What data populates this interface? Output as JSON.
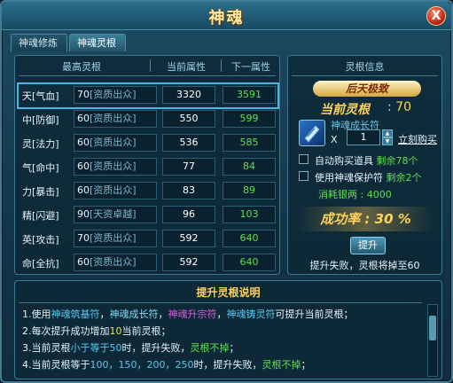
{
  "window": {
    "title": "神魂",
    "close_label": "X"
  },
  "tabs": [
    {
      "label": "神魂修炼"
    },
    {
      "label": "神魂灵根"
    }
  ],
  "table": {
    "headers": [
      "最高灵根",
      "当前属性",
      "下一属性"
    ],
    "rows": [
      {
        "name": "天[气血]",
        "level": "70",
        "quality": "[资质出众]",
        "current": "3320",
        "next": "3591"
      },
      {
        "name": "中[防御]",
        "level": "60",
        "quality": "[资质出众]",
        "current": "550",
        "next": "599"
      },
      {
        "name": "灵[法力]",
        "level": "60",
        "quality": "[资质出众]",
        "current": "536",
        "next": "585"
      },
      {
        "name": "气[命中]",
        "level": "60",
        "quality": "[资质出众]",
        "current": "77",
        "next": "84"
      },
      {
        "name": "力[暴击]",
        "level": "60",
        "quality": "[资质出众]",
        "current": "83",
        "next": "89"
      },
      {
        "name": "精[闪避]",
        "level": "90",
        "quality": "[天资卓越]",
        "current": "96",
        "next": "103"
      },
      {
        "name": "英[攻击]",
        "level": "70",
        "quality": "[资质出众]",
        "current": "592",
        "next": "640"
      },
      {
        "name": "命[全抗]",
        "level": "60",
        "quality": "[资质出众]",
        "current": "592",
        "next": "640"
      }
    ]
  },
  "info": {
    "header": "灵根信息",
    "tier": "后天极致",
    "current_label": "当前灵根",
    "current_value": ": 70",
    "item_name": "神魂成长符",
    "multiplier": "X",
    "quantity": "1",
    "buy_label": "立刻购买",
    "auto_buy": "自动购买道具",
    "auto_buy_remaining": "剩余78个",
    "use_protect": "使用神魂保护符",
    "protect_remaining": "剩余2个",
    "silver_cost": "消耗银两 : 4000",
    "success_rate": "成功率 : 30 %",
    "upgrade_button": "提升",
    "fail_note": "提升失败，灵根将掉至60"
  },
  "description": {
    "title": "提升灵根说明",
    "lines": [
      [
        "1.使用",
        "神魂筑基符",
        "，",
        "神魂成长符",
        "，",
        "神魂升宗符",
        "，",
        "神魂铸灵符",
        "可提升当前灵根；"
      ],
      [
        "2.每次提升成功增加",
        "10",
        "当前灵根；"
      ],
      [
        "3.当前灵根",
        "小于等于50",
        "时，提升失败，",
        "灵根不掉",
        "；"
      ],
      [
        "4.当前灵根等于",
        "100，150，200，250",
        "时，提升失败，",
        "灵根不掉",
        "；"
      ]
    ]
  }
}
